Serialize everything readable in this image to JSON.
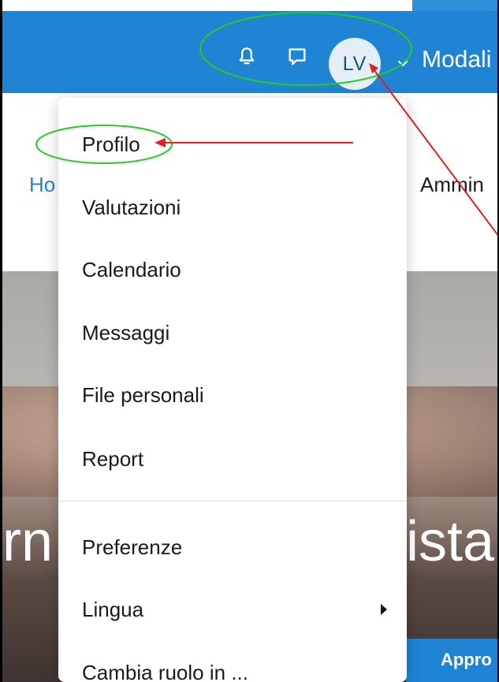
{
  "navbar": {
    "avatar_initials": "LV",
    "mode_label": "Modali",
    "icons": [
      "bell-icon",
      "chat-icon",
      "chevron-down-icon"
    ]
  },
  "subheader": {
    "left_text": "Ho",
    "right_text": "Ammin"
  },
  "menu": {
    "items": [
      {
        "label": "Profilo"
      },
      {
        "label": "Valutazioni"
      },
      {
        "label": "Calendario"
      },
      {
        "label": "Messaggi"
      },
      {
        "label": "File personali"
      },
      {
        "label": "Report"
      },
      {
        "label": "Preferenze"
      },
      {
        "label": "Lingua"
      },
      {
        "label": "Cambia ruolo in ..."
      }
    ]
  },
  "hero": {
    "text_left": "rn",
    "text_right": "ista",
    "button_label": "Appro"
  },
  "colors": {
    "navbar": "#1f84d4",
    "link": "#1f84d4",
    "annotation_green": "#22cc22",
    "annotation_red": "#e02020"
  }
}
